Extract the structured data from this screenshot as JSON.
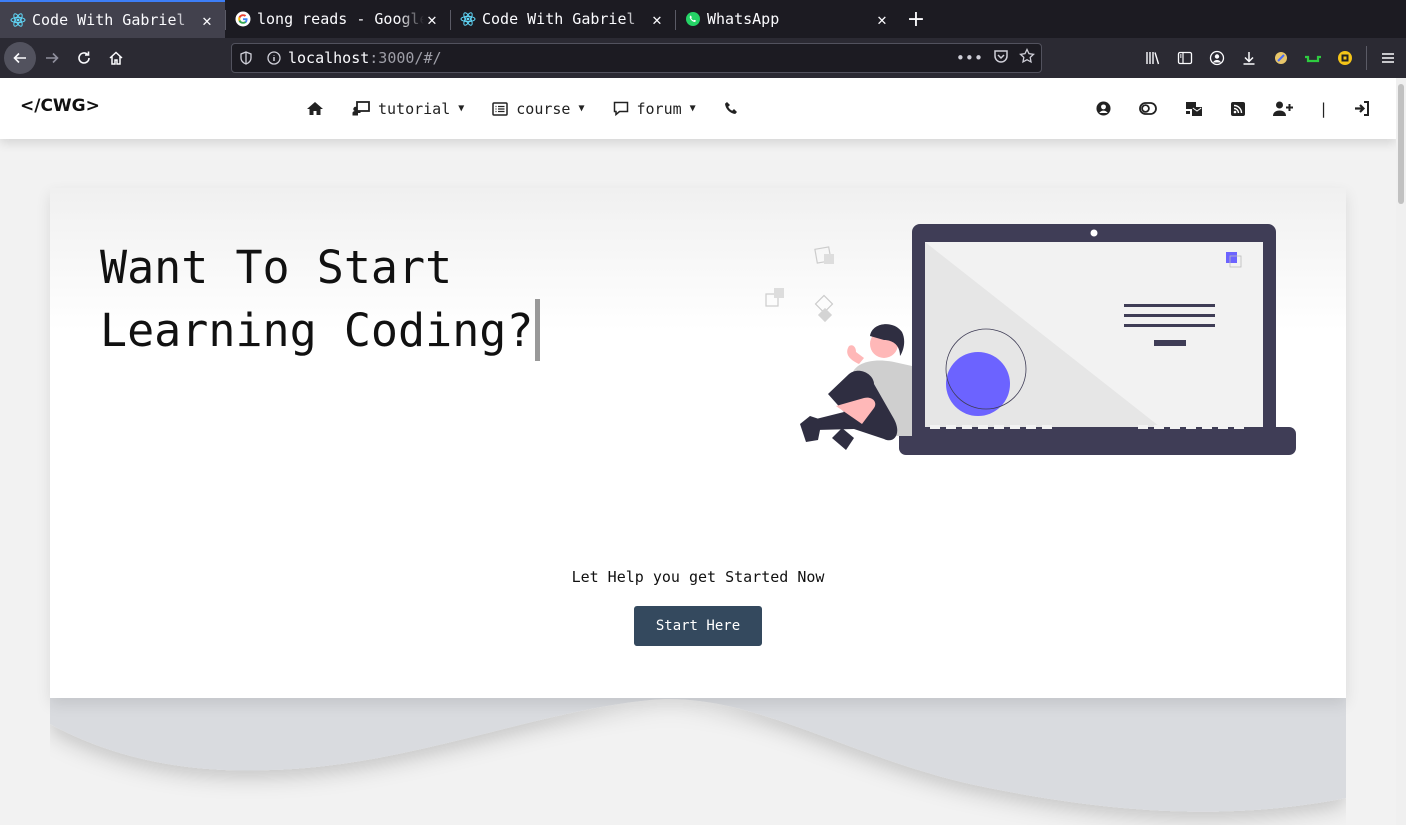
{
  "browser": {
    "tabs": [
      {
        "title": "Code With Gabriel",
        "favicon": "react-icon",
        "active": true
      },
      {
        "title": "long reads - Google Search",
        "favicon": "google-icon",
        "active": false
      },
      {
        "title": "Code With Gabriel",
        "favicon": "react-icon",
        "active": false
      },
      {
        "title": "WhatsApp",
        "favicon": "whatsapp-icon",
        "active": false
      }
    ],
    "url_host": "localhost",
    "url_path": ":3000/#/",
    "accent_color": "#3d7ef6"
  },
  "site": {
    "brand": "</CWG>",
    "menu": [
      {
        "icon": "home-icon"
      },
      {
        "icon": "chalkboard-teacher-icon",
        "label": "tutorial"
      },
      {
        "icon": "list-alt-icon",
        "label": "course"
      },
      {
        "icon": "comment-icon",
        "label": "forum"
      },
      {
        "icon": "phone-icon"
      }
    ],
    "user_icons": [
      "user-circle-icon",
      "toggle-icon",
      "mail-bulk-icon",
      "rss-icon",
      "user-plus-icon",
      "divider",
      "sign-in-icon"
    ],
    "divider_text": "|"
  },
  "hero": {
    "headline_line1": "Want To Start",
    "headline_line2": "Learning Coding?",
    "cta_text": "Let Help you get Started Now",
    "cta_button": "Start Here",
    "button_color": "#34495e",
    "illustration_accent": "#6c63ff",
    "illustration_dark": "#3f3d56"
  }
}
